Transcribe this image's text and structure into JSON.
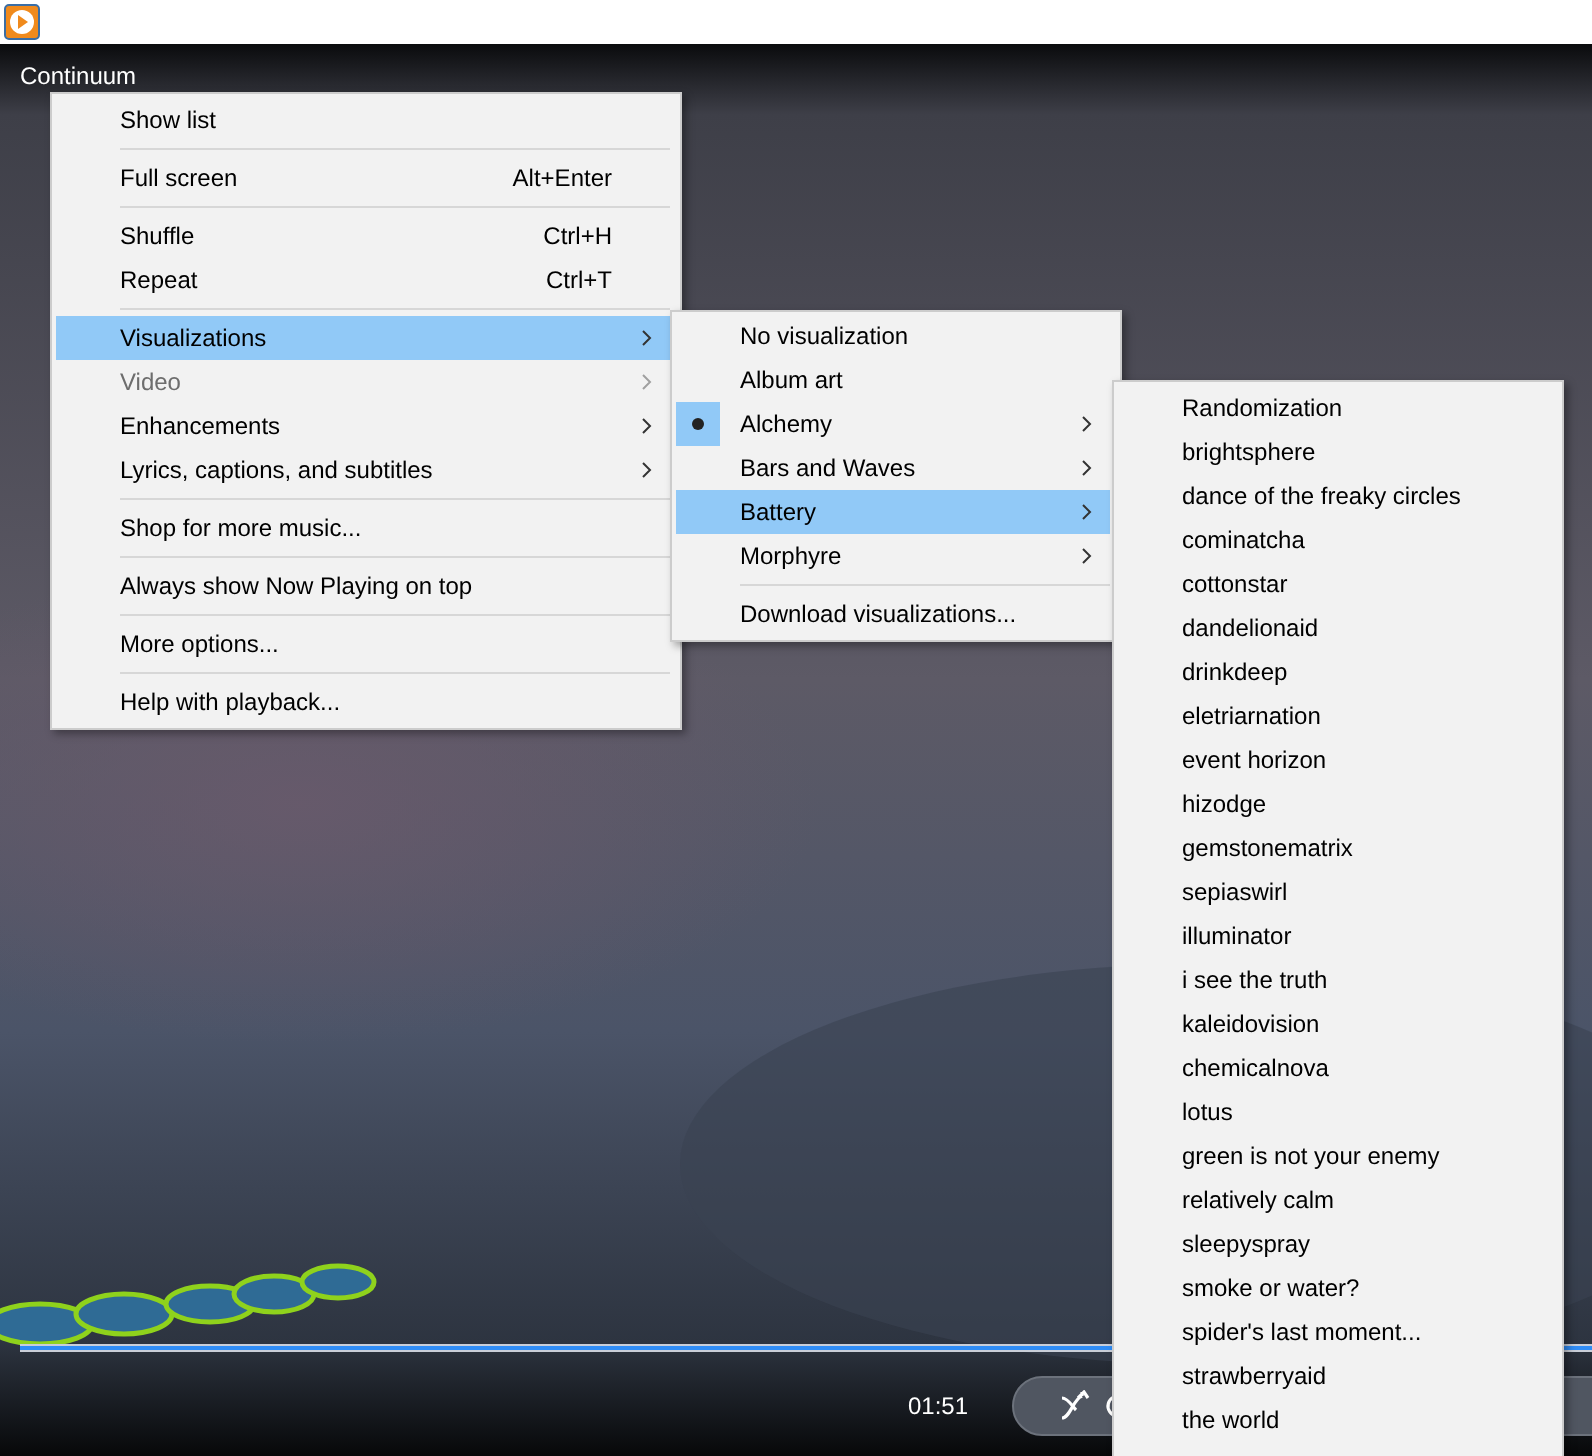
{
  "window": {
    "title_bar": {
      "kind": "app"
    }
  },
  "player": {
    "track_title": "Continuum",
    "seek": {
      "level": 1
    },
    "elapsed": "01:51"
  },
  "main_menu": {
    "items": [
      {
        "kind": "item",
        "label": "Show list",
        "selected": false,
        "disabled": false,
        "has_submenu": false
      },
      {
        "kind": "separator"
      },
      {
        "kind": "item",
        "label": "Full screen",
        "shortcut": "Alt+Enter",
        "selected": false,
        "disabled": false,
        "has_submenu": false
      },
      {
        "kind": "separator"
      },
      {
        "kind": "item",
        "label": "Shuffle",
        "shortcut": "Ctrl+H",
        "selected": false,
        "disabled": false,
        "has_submenu": false
      },
      {
        "kind": "item",
        "label": "Repeat",
        "shortcut": "Ctrl+T",
        "selected": false,
        "disabled": false,
        "has_submenu": false
      },
      {
        "kind": "separator"
      },
      {
        "kind": "item",
        "label": "Visualizations",
        "selected": true,
        "disabled": false,
        "has_submenu": true
      },
      {
        "kind": "item",
        "label": "Video",
        "selected": false,
        "disabled": true,
        "has_submenu": true
      },
      {
        "kind": "item",
        "label": "Enhancements",
        "selected": false,
        "disabled": false,
        "has_submenu": true
      },
      {
        "kind": "item",
        "label": "Lyrics, captions, and subtitles",
        "selected": false,
        "disabled": false,
        "has_submenu": true
      },
      {
        "kind": "separator"
      },
      {
        "kind": "item",
        "label": "Shop for more music...",
        "selected": false,
        "disabled": false,
        "has_submenu": false
      },
      {
        "kind": "separator"
      },
      {
        "kind": "item",
        "label": "Always show Now Playing on top",
        "selected": false,
        "disabled": false,
        "has_submenu": false
      },
      {
        "kind": "separator"
      },
      {
        "kind": "item",
        "label": "More options...",
        "selected": false,
        "disabled": false,
        "has_submenu": false
      },
      {
        "kind": "separator"
      },
      {
        "kind": "item",
        "label": "Help with playback...",
        "selected": false,
        "disabled": false,
        "has_submenu": false
      }
    ]
  },
  "visualizations_menu": {
    "items": [
      {
        "kind": "item",
        "label": "No visualization",
        "checked": false,
        "selected": false,
        "has_submenu": false
      },
      {
        "kind": "item",
        "label": "Album art",
        "checked": false,
        "selected": false,
        "has_submenu": false
      },
      {
        "kind": "item",
        "label": "Alchemy",
        "checked": true,
        "selected": false,
        "has_submenu": true
      },
      {
        "kind": "item",
        "label": "Bars and Waves",
        "checked": false,
        "selected": false,
        "has_submenu": true
      },
      {
        "kind": "item",
        "label": "Battery",
        "checked": false,
        "selected": true,
        "has_submenu": true
      },
      {
        "kind": "item",
        "label": "Morphyre",
        "checked": false,
        "selected": false,
        "has_submenu": true
      },
      {
        "kind": "separator"
      },
      {
        "kind": "item",
        "label": "Download visualizations...",
        "checked": false,
        "selected": false,
        "has_submenu": false
      }
    ]
  },
  "battery_menu": {
    "items": [
      {
        "label": "Randomization"
      },
      {
        "label": "brightsphere"
      },
      {
        "label": "dance of the freaky circles"
      },
      {
        "label": "cominatcha"
      },
      {
        "label": "cottonstar"
      },
      {
        "label": "dandelionaid"
      },
      {
        "label": "drinkdeep"
      },
      {
        "label": "eletriarnation"
      },
      {
        "label": "event horizon"
      },
      {
        "label": "hizodge"
      },
      {
        "label": "gemstonematrix"
      },
      {
        "label": "sepiaswirl"
      },
      {
        "label": "illuminator"
      },
      {
        "label": "i see the truth"
      },
      {
        "label": "kaleidovision"
      },
      {
        "label": "chemicalnova"
      },
      {
        "label": "lotus"
      },
      {
        "label": "green is not your enemy"
      },
      {
        "label": "relatively calm"
      },
      {
        "label": "sleepyspray"
      },
      {
        "label": "smoke or water?"
      },
      {
        "label": "spider's last moment..."
      },
      {
        "label": "strawberryaid"
      },
      {
        "label": "the world"
      }
    ]
  }
}
